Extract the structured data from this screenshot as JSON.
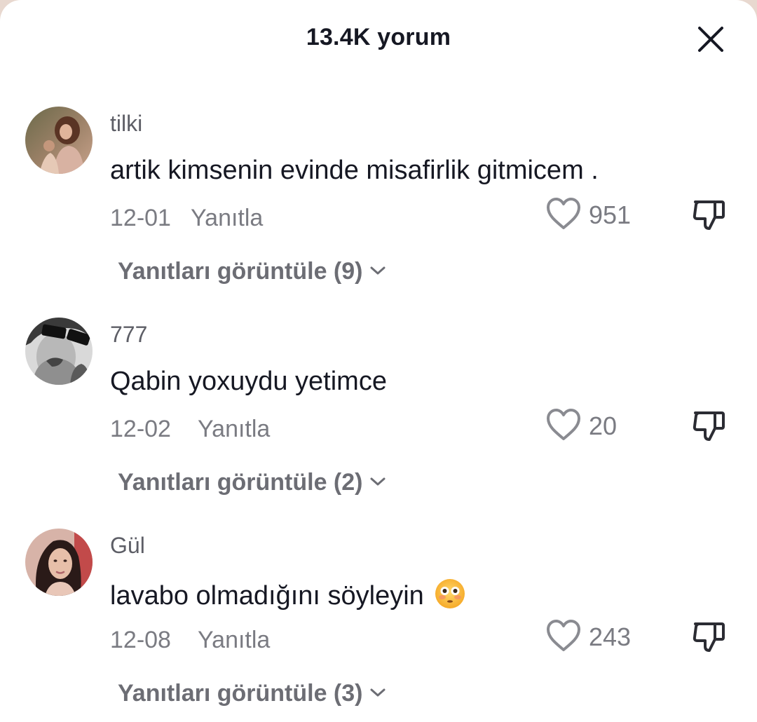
{
  "header": {
    "title": "13.4K yorum"
  },
  "comments": [
    {
      "username": "tilki",
      "text": "artik kimsenin evinde misafirlik gitmicem .",
      "date": "12-01",
      "reply_label": "Yanıtla",
      "likes": "951",
      "view_replies": "Yanıtları görüntüle (9)"
    },
    {
      "username": "777",
      "text": "Qabin yoxuydu yetimce",
      "date": "12-02",
      "reply_label": "Yanıtla",
      "likes": "20",
      "view_replies": "Yanıtları görüntüle (2)"
    },
    {
      "username": "Gül",
      "text": "lavabo olmadığını söyleyin",
      "emoji": "flushed-face-emoji",
      "date": "12-08",
      "reply_label": "Yanıtla",
      "likes": "243",
      "view_replies": "Yanıtları görüntüle (3)"
    }
  ],
  "colors": {
    "primary_text": "#161823",
    "secondary_text": "#7a7b82",
    "background": "#ffffff"
  }
}
